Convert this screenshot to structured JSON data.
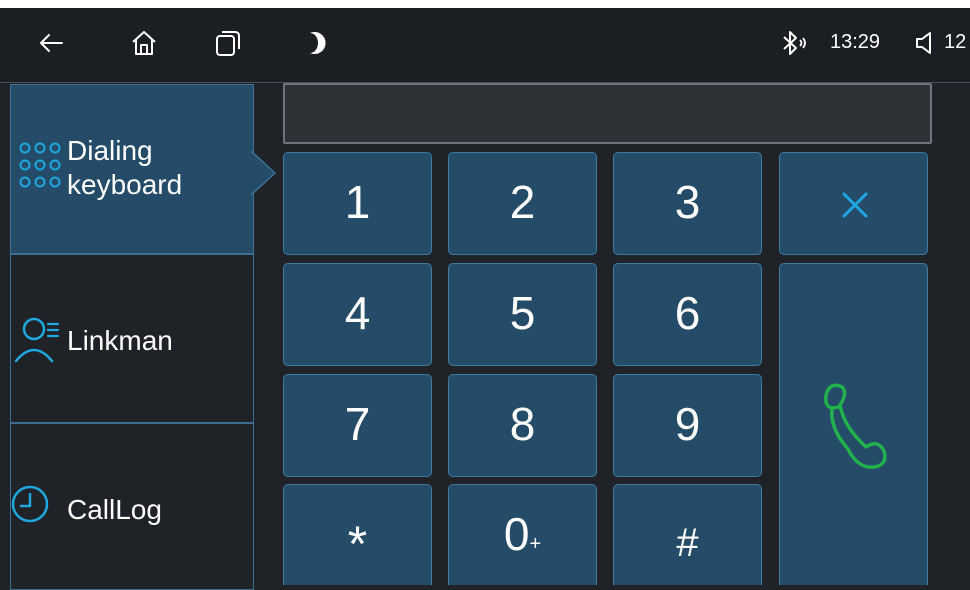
{
  "status_bar": {
    "time": "13:29",
    "volume": "12",
    "icons": [
      "back-arrow-icon",
      "home-icon",
      "recent-apps-icon",
      "moon-icon",
      "bluetooth-icon",
      "volume-icon"
    ]
  },
  "sidebar": {
    "items": [
      {
        "label_line1": "Dialing",
        "label_line2": "keyboard",
        "icon": "dialpad-icon",
        "active": true
      },
      {
        "label": "Linkman",
        "icon": "contacts-icon",
        "active": false
      },
      {
        "label": "CallLog",
        "icon": "clock-icon",
        "active": false
      }
    ]
  },
  "dialer": {
    "number": "",
    "keys": [
      "1",
      "2",
      "3",
      "4",
      "5",
      "6",
      "7",
      "8",
      "9",
      "*",
      "0",
      "#"
    ],
    "zero_sub": "+",
    "delete_icon": "close-icon",
    "call_icon": "phone-handset-icon",
    "colors": {
      "accent": "#1ea7e0",
      "call": "#22b14c",
      "key_bg": "#244b68"
    }
  }
}
